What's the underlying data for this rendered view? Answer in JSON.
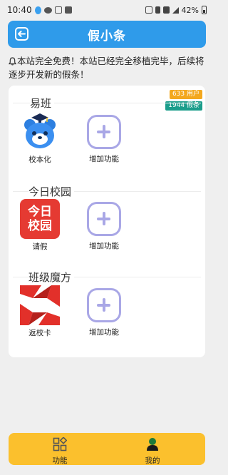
{
  "status_bar": {
    "time": "10:40",
    "battery": "42%"
  },
  "header": {
    "title": "假小条"
  },
  "notice": "本站完全免费！本站已经完全移植完毕，后续将逐步开发新的假条！",
  "stats": {
    "users": "633 用户",
    "posts": "1944 假条"
  },
  "sections": [
    {
      "title": "易班",
      "items": [
        {
          "label": "校本化",
          "icon": "yiban-bear-icon"
        },
        {
          "label": "增加功能",
          "icon": "add-function-icon"
        }
      ]
    },
    {
      "title": "今日校园",
      "items": [
        {
          "label": "请假",
          "icon": "jinri-xiaoyuan-icon",
          "logo_text": [
            "今日",
            "校园"
          ]
        },
        {
          "label": "增加功能",
          "icon": "add-function-icon"
        }
      ]
    },
    {
      "title": "班级魔方",
      "items": [
        {
          "label": "返校卡",
          "icon": "banji-mofang-icon"
        },
        {
          "label": "增加功能",
          "icon": "add-function-icon"
        }
      ]
    }
  ],
  "bottom_nav": [
    {
      "label": "功能",
      "icon": "grid-icon"
    },
    {
      "label": "我的",
      "icon": "user-icon"
    }
  ],
  "colors": {
    "header": "#2f9bea",
    "bottom_nav": "#fbc02d",
    "add_icon": "#a9a7e6",
    "badge_users": "#f3a81e",
    "badge_posts": "#1b9d8b"
  }
}
